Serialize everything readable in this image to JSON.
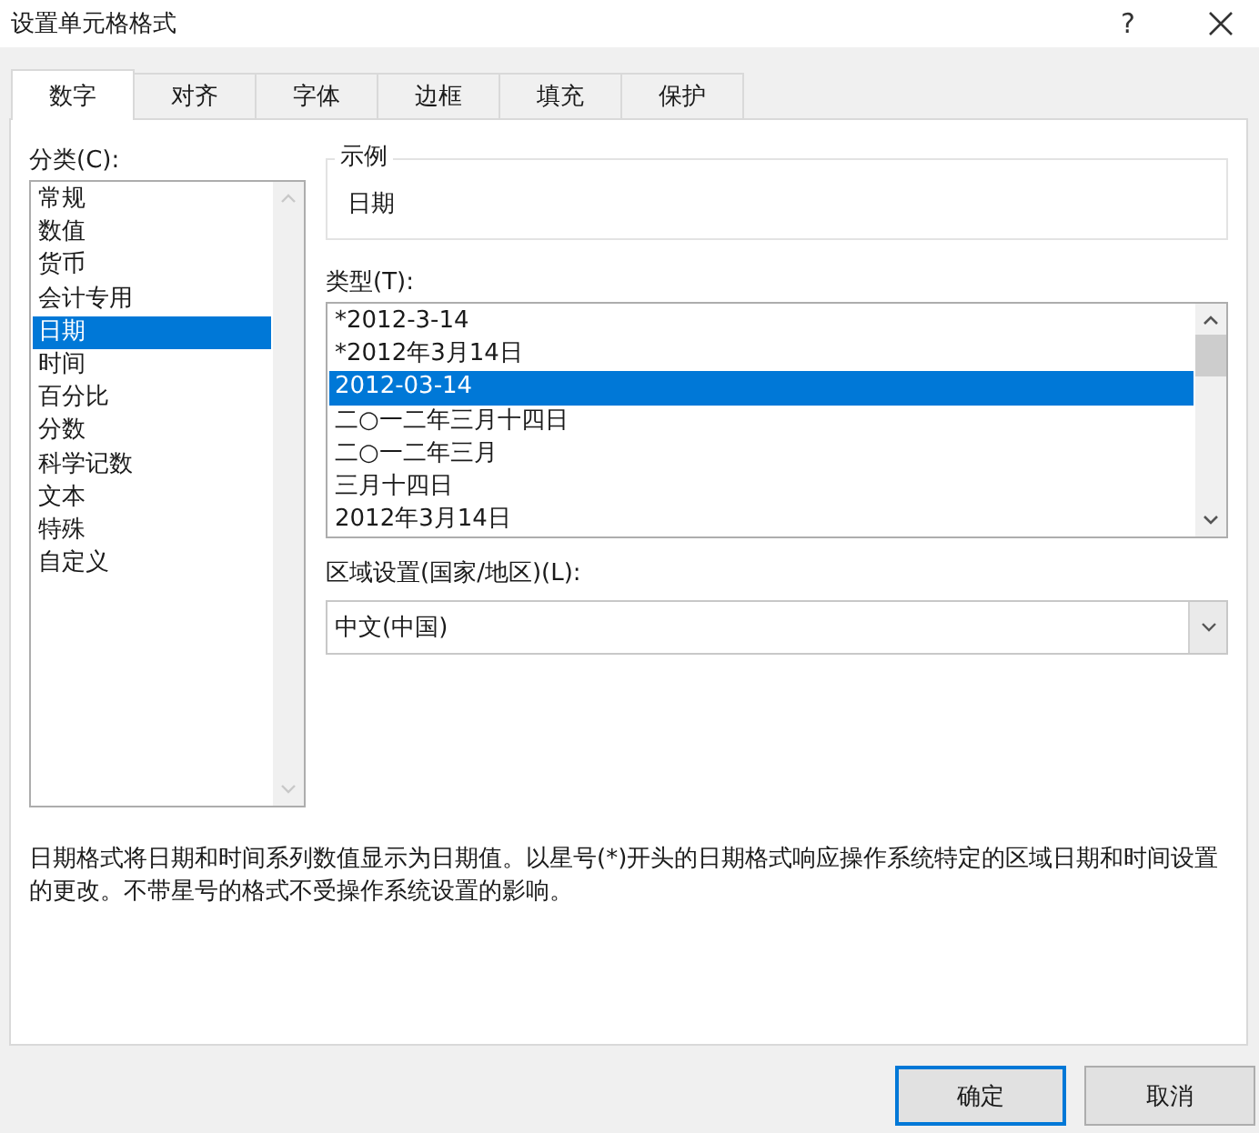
{
  "window": {
    "title": "设置单元格格式",
    "help": "?"
  },
  "tabs": [
    {
      "label": "数字",
      "selected": true
    },
    {
      "label": "对齐",
      "selected": false
    },
    {
      "label": "字体",
      "selected": false
    },
    {
      "label": "边框",
      "selected": false
    },
    {
      "label": "填充",
      "selected": false
    },
    {
      "label": "保护",
      "selected": false
    }
  ],
  "category": {
    "label": "分类(C):",
    "items": [
      {
        "label": "常规",
        "selected": false
      },
      {
        "label": "数值",
        "selected": false
      },
      {
        "label": "货币",
        "selected": false
      },
      {
        "label": "会计专用",
        "selected": false
      },
      {
        "label": "日期",
        "selected": true
      },
      {
        "label": "时间",
        "selected": false
      },
      {
        "label": "百分比",
        "selected": false
      },
      {
        "label": "分数",
        "selected": false
      },
      {
        "label": "科学记数",
        "selected": false
      },
      {
        "label": "文本",
        "selected": false
      },
      {
        "label": "特殊",
        "selected": false
      },
      {
        "label": "自定义",
        "selected": false
      }
    ]
  },
  "sample": {
    "label": "示例",
    "value": "日期"
  },
  "type": {
    "label": "类型(T):",
    "items": [
      {
        "label": "*2012-3-14",
        "selected": false
      },
      {
        "label": "*2012年3月14日",
        "selected": false
      },
      {
        "label": "2012-03-14",
        "selected": true
      },
      {
        "label": "二○一二年三月十四日",
        "selected": false
      },
      {
        "label": "二○一二年三月",
        "selected": false
      },
      {
        "label": "三月十四日",
        "selected": false
      },
      {
        "label": "2012年3月14日",
        "selected": false
      }
    ]
  },
  "locale": {
    "label": "区域设置(国家/地区)(L):",
    "value": "中文(中国)"
  },
  "description": "日期格式将日期和时间系列数值显示为日期值。以星号(*)开头的日期格式响应操作系统特定的区域日期和时间设置的更改。不带星号的格式不受操作系统设置的影响。",
  "buttons": [
    {
      "label": "确定",
      "default": true
    },
    {
      "label": "取消",
      "default": false
    }
  ]
}
